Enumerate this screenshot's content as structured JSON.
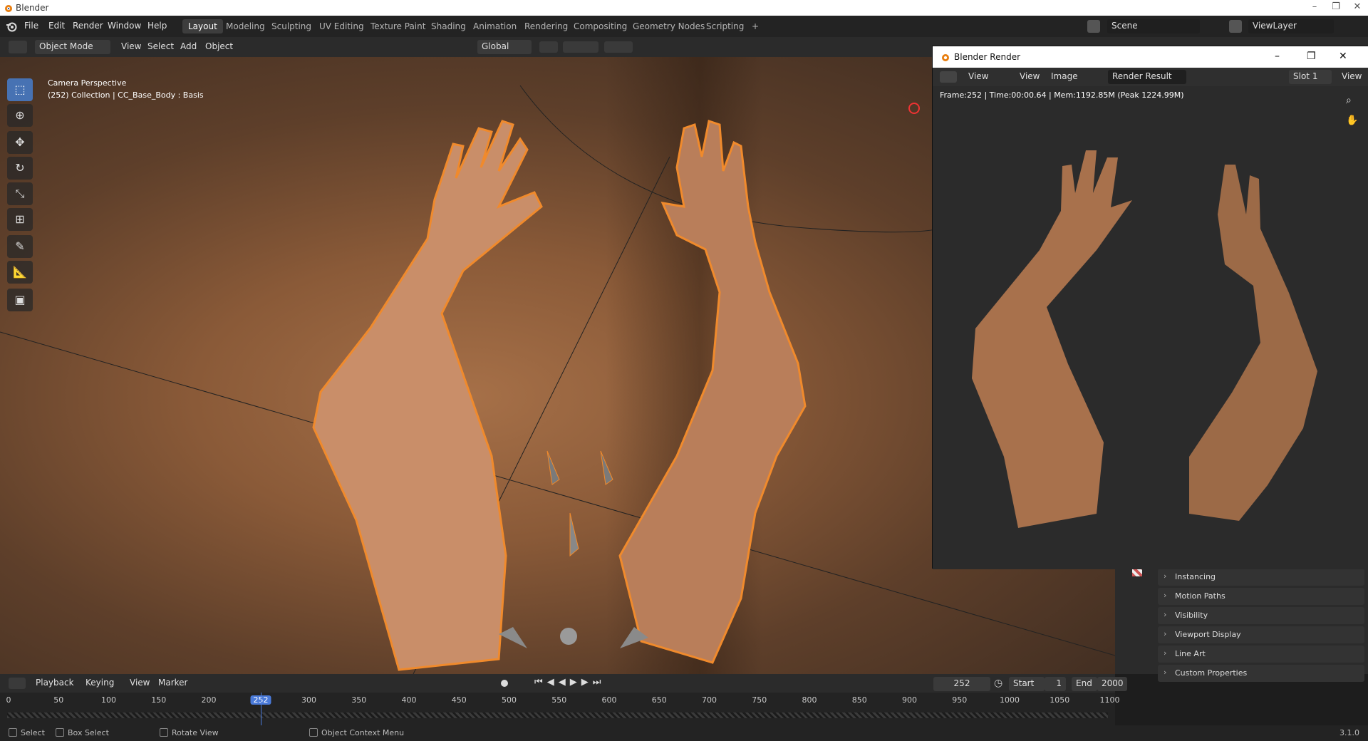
{
  "window": {
    "title": "Blender",
    "minimize": "–",
    "maximize": "❐",
    "close": "✕"
  },
  "menu": [
    "File",
    "Edit",
    "Render",
    "Window",
    "Help"
  ],
  "workspaces": [
    "Layout",
    "Modeling",
    "Sculpting",
    "UV Editing",
    "Texture Paint",
    "Shading",
    "Animation",
    "Rendering",
    "Compositing",
    "Geometry Nodes",
    "Scripting"
  ],
  "active_workspace": "Layout",
  "add_workspace": "+",
  "scene": {
    "name": "Scene",
    "view_layer": "ViewLayer"
  },
  "header": {
    "mode": "Object Mode",
    "view": "View",
    "select": "Select",
    "add": "Add",
    "object": "Object",
    "orientation": "Global"
  },
  "viewport": {
    "camera_label": "Camera Perspective",
    "collection_label": "(252) Collection | CC_Base_Body : Basis"
  },
  "tools": [
    "select-box-icon",
    "cursor-icon",
    "move-icon",
    "rotate-icon",
    "scale-icon",
    "transform-icon",
    "annotate-icon",
    "measure-icon",
    "add-cube-icon"
  ],
  "render_window": {
    "title": "Blender Render",
    "view_menu": "View",
    "view": "View",
    "image": "Image",
    "image_name": "Render Result",
    "slot": "Slot 1",
    "view_right": "View",
    "info": "Frame:252 | Time:00:00.64 | Mem:1192.85M (Peak 1224.99M)"
  },
  "properties_panels": [
    "Instancing",
    "Motion Paths",
    "Visibility",
    "Viewport Display",
    "Line Art",
    "Custom Properties"
  ],
  "timeline": {
    "playback": "Playback",
    "keying": "Keying",
    "view": "View",
    "marker": "Marker",
    "current_frame": "252",
    "start_label": "Start",
    "start": "1",
    "end_label": "End",
    "end": "2000",
    "ticks": [
      "0",
      "50",
      "100",
      "150",
      "200",
      "252",
      "300",
      "350",
      "400",
      "450",
      "500",
      "550",
      "600",
      "650",
      "700",
      "750",
      "800",
      "850",
      "900",
      "950",
      "1000",
      "1050",
      "1100"
    ]
  },
  "status": {
    "select": "Select",
    "box_select": "Box Select",
    "rotate_view": "Rotate View",
    "context_menu": "Object Context Menu",
    "version": "3.1.0"
  },
  "colors": {
    "accent": "#4772b3",
    "selection_outline": "#f08a2c",
    "frame_marker": "#4a7ad9"
  }
}
